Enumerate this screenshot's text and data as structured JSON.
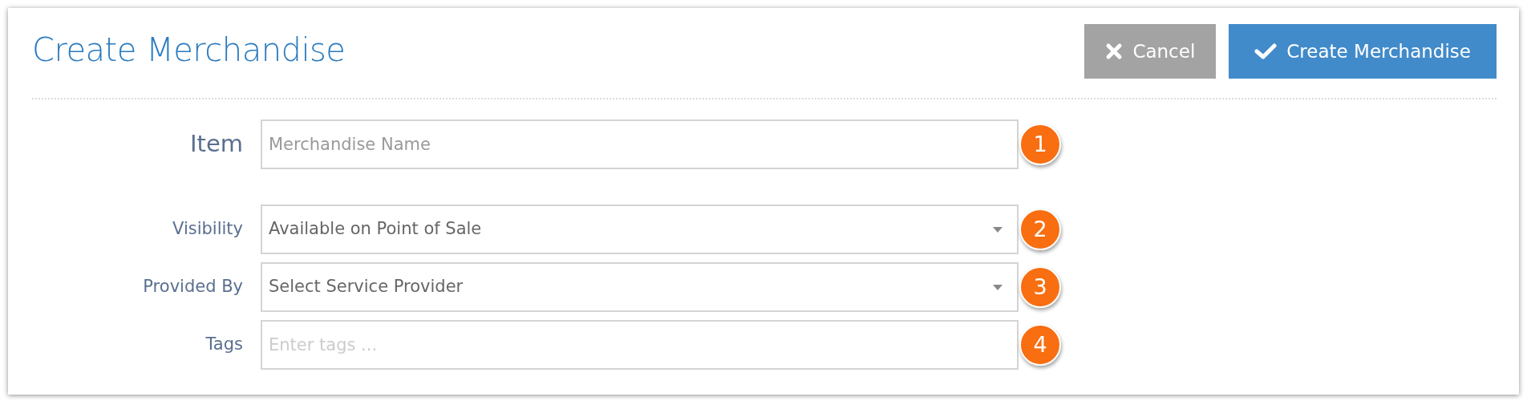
{
  "title": "Create Merchandise",
  "buttons": [
    {
      "kind": "cancel",
      "label": "Cancel"
    },
    {
      "kind": "create",
      "label": "Create Merchandise"
    }
  ],
  "fields": [
    {
      "kind": "input",
      "label": "Item",
      "placeholder": "Merchandise Name",
      "badge": "1",
      "emphasis": true
    },
    {
      "kind": "select",
      "label": "Visibility",
      "value": "Available on Point of Sale",
      "badge": "2"
    },
    {
      "kind": "select",
      "label": "Provided By",
      "value": "Select Service Provider",
      "badge": "3"
    },
    {
      "kind": "input",
      "label": "Tags",
      "placeholder": "Enter tags ...",
      "badge": "4"
    }
  ]
}
